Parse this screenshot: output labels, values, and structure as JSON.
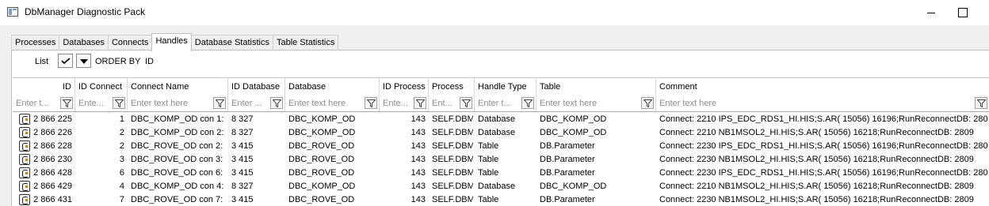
{
  "window": {
    "title": "DbManager Diagnostic Pack"
  },
  "tabs": [
    {
      "label": "Processes",
      "active": false
    },
    {
      "label": "Databases",
      "active": false
    },
    {
      "label": "Connects",
      "active": false
    },
    {
      "label": "Handles",
      "active": true
    },
    {
      "label": "Database Statistics",
      "active": false
    },
    {
      "label": "Table Statistics",
      "active": false
    }
  ],
  "toolbar": {
    "list_label": "List",
    "list_checked": true,
    "order_by_label": "ORDER BY",
    "order_by_value": "ID"
  },
  "columns": [
    {
      "key": "id",
      "label": "ID",
      "filter_placeholder": "Enter t..."
    },
    {
      "key": "id_connect",
      "label": "ID Connect",
      "filter_placeholder": "Ente..."
    },
    {
      "key": "connect_name",
      "label": "Connect Name",
      "filter_placeholder": "Enter text here"
    },
    {
      "key": "id_database",
      "label": "ID Database",
      "filter_placeholder": "Enter ..."
    },
    {
      "key": "database",
      "label": "Database",
      "filter_placeholder": "Enter text here"
    },
    {
      "key": "id_process",
      "label": "ID Process",
      "filter_placeholder": "Ente..."
    },
    {
      "key": "process",
      "label": "Process",
      "filter_placeholder": "Ent..."
    },
    {
      "key": "handle_type",
      "label": "Handle Type",
      "filter_placeholder": "Enter t..."
    },
    {
      "key": "table",
      "label": "Table",
      "filter_placeholder": "Enter text here"
    },
    {
      "key": "comment",
      "label": "Comment",
      "filter_placeholder": "Enter text here"
    }
  ],
  "rows": [
    {
      "icon": "handle-icon",
      "id": "2 866 225",
      "id_connect": "1",
      "connect_name": "DBC_KOMP_OD con 1:",
      "id_database": "8 327",
      "database": "DBC_KOMP_OD",
      "id_process": "143",
      "process": "SELF.DBM",
      "handle_type": "Database",
      "table": "DBC_KOMP_OD",
      "comment": "Connect: 2210 IPS_EDC_RDS1_HI.HIS;S.AR( 15056) 16196;RunReconnectDB: 2809"
    },
    {
      "icon": "handle-icon",
      "id": "2 866 226",
      "id_connect": "2",
      "connect_name": "DBC_KOMP_OD con 2:",
      "id_database": "8 327",
      "database": "DBC_KOMP_OD",
      "id_process": "143",
      "process": "SELF.DBM",
      "handle_type": "Database",
      "table": "DBC_KOMP_OD",
      "comment": "Connect: 2210 NB1MSOL2_HI.HIS;S.AR( 15056) 16218;RunReconnectDB: 2809"
    },
    {
      "icon": "handle-icon",
      "id": "2 866 228",
      "id_connect": "2",
      "connect_name": "DBC_ROVE_OD con 2:",
      "id_database": "3 415",
      "database": "DBC_ROVE_OD",
      "id_process": "143",
      "process": "SELF.DBM",
      "handle_type": "Table",
      "table": "DB.Parameter",
      "comment": "Connect: 2230 IPS_EDC_RDS1_HI.HIS;S.AR( 15056) 16196;RunReconnectDB: 2809"
    },
    {
      "icon": "handle-icon",
      "id": "2 866 230",
      "id_connect": "3",
      "connect_name": "DBC_ROVE_OD con 3:",
      "id_database": "3 415",
      "database": "DBC_ROVE_OD",
      "id_process": "143",
      "process": "SELF.DBM",
      "handle_type": "Table",
      "table": "DB.Parameter",
      "comment": "Connect: 2230 NB1MSOL2_HI.HIS;S.AR( 15056) 16218;RunReconnectDB: 2809"
    },
    {
      "icon": "handle-icon",
      "id": "2 866 428",
      "id_connect": "6",
      "connect_name": "DBC_ROVE_OD con 6:",
      "id_database": "3 415",
      "database": "DBC_ROVE_OD",
      "id_process": "143",
      "process": "SELF.DBM",
      "handle_type": "Table",
      "table": "DB.Parameter",
      "comment": "Connect: 2230 IPS_EDC_RDS1_HI.HIS;S.AR( 15056) 16196;RunReconnectDB: 2809"
    },
    {
      "icon": "handle-icon",
      "id": "2 866 429",
      "id_connect": "4",
      "connect_name": "DBC_KOMP_OD con 4:",
      "id_database": "8 327",
      "database": "DBC_KOMP_OD",
      "id_process": "143",
      "process": "SELF.DBM",
      "handle_type": "Database",
      "table": "DBC_KOMP_OD",
      "comment": "Connect: 2210 NB1MSOL2_HI.HIS;S.AR( 15056) 16218;RunReconnectDB: 2809"
    },
    {
      "icon": "handle-icon",
      "id": "2 866 431",
      "id_connect": "7",
      "connect_name": "DBC_ROVE_OD con 7:",
      "id_database": "3 415",
      "database": "DBC_ROVE_OD",
      "id_process": "143",
      "process": "SELF.DBM",
      "handle_type": "Table",
      "table": "DB.Parameter",
      "comment": "Connect: 2230 NB1MSOL2_HI.HIS;S.AR( 15056) 16218;RunReconnectDB: 2809"
    }
  ]
}
